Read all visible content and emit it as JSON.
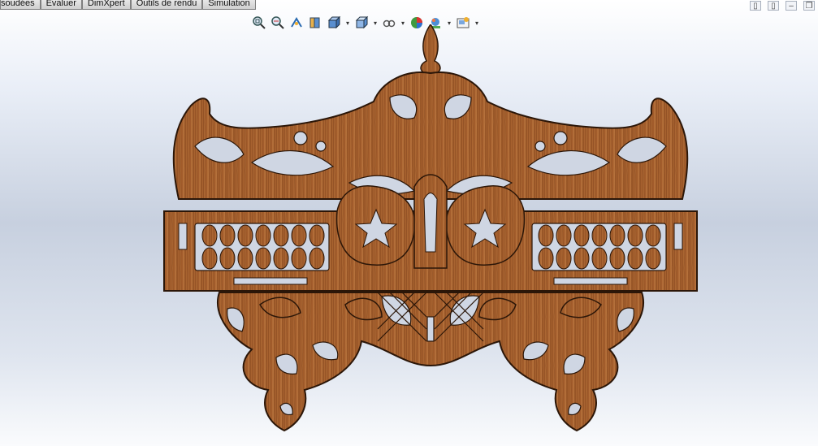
{
  "command_tabs": [
    "soudées",
    "Évaluer",
    "DimXpert",
    "Outils de rendu",
    "Simulation"
  ],
  "window_buttons": [
    "restore-left-icon",
    "restore-right-icon",
    "minimize-icon",
    "maximize-icon"
  ],
  "hud_toolbar": {
    "buttons": [
      {
        "icon": "zoom-to-fit-icon"
      },
      {
        "icon": "zoom-to-area-icon"
      },
      {
        "icon": "previous-view-icon"
      },
      {
        "icon": "section-view-icon"
      },
      {
        "icon": "view-orientation-icon",
        "dropdown": true
      },
      {
        "icon": "display-style-icon",
        "dropdown": true
      },
      {
        "icon": "hide-show-items-icon",
        "dropdown": true
      },
      {
        "icon": "edit-appearance-icon"
      },
      {
        "icon": "apply-scene-icon",
        "dropdown": true
      },
      {
        "icon": "view-settings-icon",
        "dropdown": true
      }
    ]
  },
  "colors": {
    "wood_light": "#b06a35",
    "wood_dark": "#6e3a17",
    "outline": "#2b1608",
    "viewport_mid": "#c7d0df"
  }
}
